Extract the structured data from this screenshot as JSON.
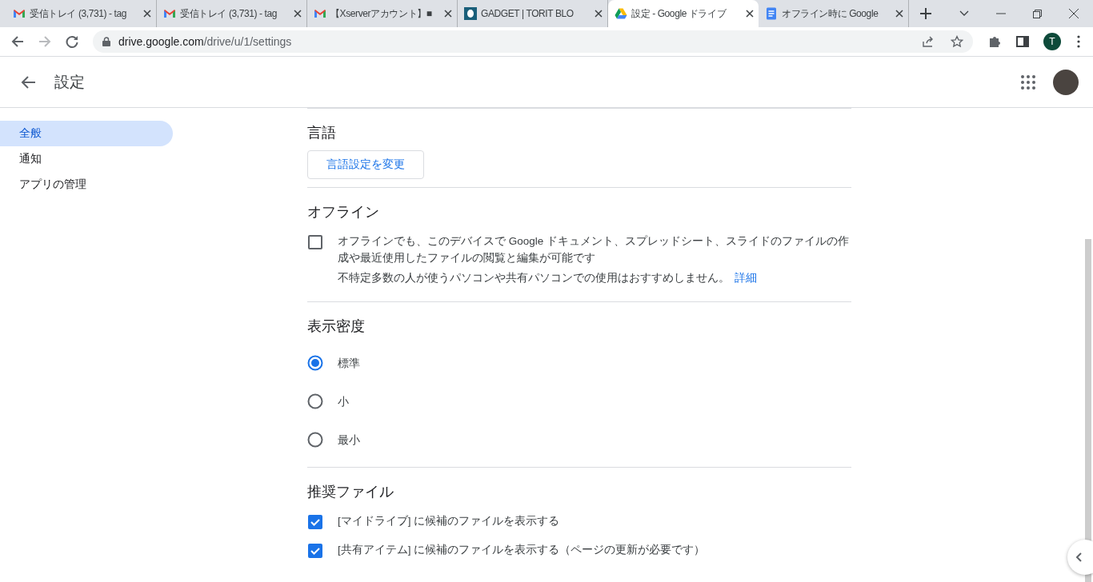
{
  "browser": {
    "tabs": [
      {
        "kind": "mail",
        "title": "受信トレイ (3,731) - tag",
        "selected": false
      },
      {
        "kind": "mail",
        "title": "受信トレイ (3,731) - tag",
        "selected": false
      },
      {
        "kind": "mail",
        "title": "【Xserverアカウント】■",
        "selected": false
      },
      {
        "kind": "blog",
        "title": "GADGET | TORIT BLO",
        "selected": false
      },
      {
        "kind": "drive",
        "title": "設定 - Google ドライブ",
        "selected": true
      },
      {
        "kind": "docs",
        "title": "オフライン時に Google",
        "selected": false
      }
    ],
    "url_host": "drive.google.com",
    "url_path": "/drive/u/1/settings",
    "profile_initial": "T"
  },
  "header": {
    "title": "設定"
  },
  "sidebar": {
    "items": [
      {
        "label": "全般",
        "selected": true
      },
      {
        "label": "通知",
        "selected": false
      },
      {
        "label": "アプリの管理",
        "selected": false
      }
    ]
  },
  "sections": [
    {
      "title": "言語",
      "items": [
        {
          "kind": "button",
          "label": "言語設定を変更"
        }
      ]
    },
    {
      "title": "オフライン",
      "items": [
        {
          "kind": "checkbox",
          "label": "オフラインでも、このデバイスで Google ドキュメント、スプレッドシート、スライドのファイルの作成や最近使用したファイルの閲覧と編集が可能です",
          "checked": false,
          "note": "不特定多数の人が使うパソコンや共有パソコンでの使用はおすすめしません。",
          "link": "詳細"
        }
      ]
    },
    {
      "title": "表示密度",
      "items": [
        {
          "kind": "radio",
          "label": "標準",
          "selected": true
        },
        {
          "kind": "radio",
          "label": "小",
          "selected": false
        },
        {
          "kind": "radio",
          "label": "最小",
          "selected": false
        }
      ]
    },
    {
      "title": "推奨ファイル",
      "items": [
        {
          "kind": "checkbox",
          "label": "[マイドライブ] に候補のファイルを表示する",
          "checked": true
        },
        {
          "kind": "checkbox",
          "label": "[共有アイテム] に候補のファイルを表示する（ページの更新が必要です）",
          "checked": true
        }
      ]
    }
  ]
}
